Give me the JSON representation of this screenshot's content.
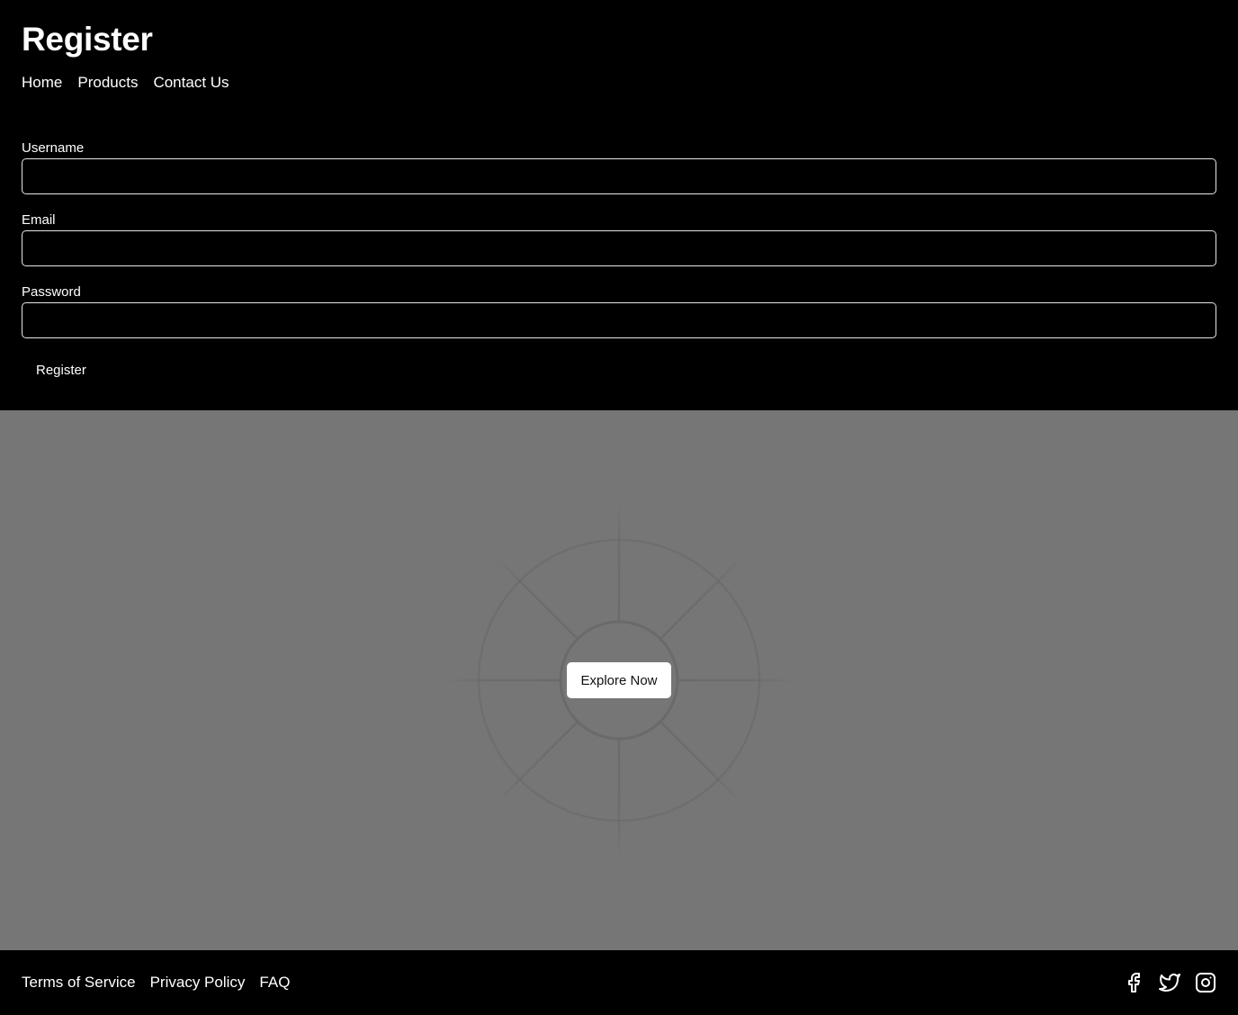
{
  "header": {
    "title": "Register",
    "nav": [
      {
        "label": "Home"
      },
      {
        "label": "Products"
      },
      {
        "label": "Contact Us"
      }
    ]
  },
  "form": {
    "username": {
      "label": "Username",
      "value": "",
      "placeholder": ""
    },
    "email": {
      "label": "Email",
      "value": "",
      "placeholder": ""
    },
    "password": {
      "label": "Password",
      "value": "",
      "placeholder": ""
    },
    "submit_label": "Register"
  },
  "hero": {
    "cta_label": "Explore Now",
    "background_color": "#767676"
  },
  "footer": {
    "links": [
      {
        "label": "Terms of Service"
      },
      {
        "label": "Privacy Policy"
      },
      {
        "label": "FAQ"
      }
    ],
    "social": [
      {
        "icon": "facebook-icon"
      },
      {
        "icon": "twitter-icon"
      },
      {
        "icon": "instagram-icon"
      }
    ]
  },
  "colors": {
    "background": "#000000",
    "text": "#ffffff",
    "hero": "#767676",
    "button": "#ffffff"
  }
}
